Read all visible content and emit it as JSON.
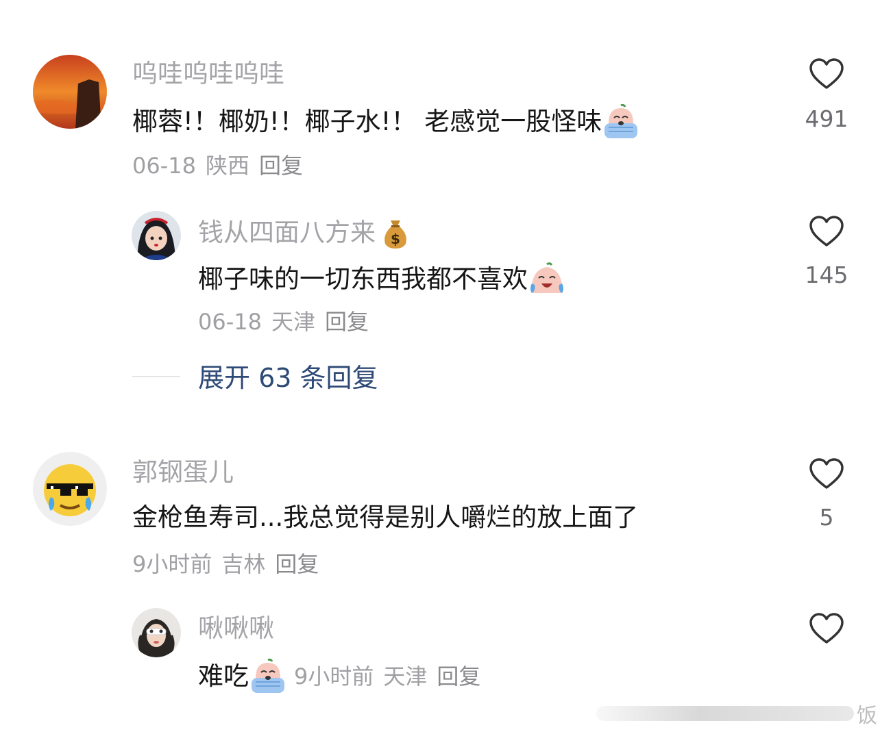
{
  "comments": [
    {
      "username": "呜哇呜哇呜哇",
      "text": "椰蓉!！椰奶!！椰子水!！ 老感觉一股怪味",
      "date": "06-18",
      "location": "陕西",
      "reply_label": "回复",
      "likes": "491",
      "emoji": "crying-face-emoji"
    },
    {
      "username": "钱从四面八方来",
      "username_emoji": "money-bag-emoji",
      "text": "椰子味的一切东西我都不喜欢",
      "date": "06-18",
      "location": "天津",
      "reply_label": "回复",
      "likes": "145",
      "emoji": "tears-of-joy-face-emoji"
    },
    {
      "username": "郭钢蛋儿",
      "text": "金枪鱼寿司...我总觉得是别人嚼烂的放上面了",
      "date": "9小时前",
      "location": "吉林",
      "reply_label": "回复",
      "likes": "5"
    },
    {
      "username": "啾啾啾",
      "text": "难吃",
      "date": "9小时前",
      "location": "天津",
      "reply_label": "回复",
      "likes": "",
      "emoji": "crying-face-emoji"
    }
  ],
  "expand_replies": "展开 63 条回复",
  "watermark": "饭",
  "colors": {
    "username": "#a4a4a8",
    "text": "#161616",
    "meta": "#a0a0a4",
    "expand": "#2e4a77",
    "heart": "#333333"
  }
}
